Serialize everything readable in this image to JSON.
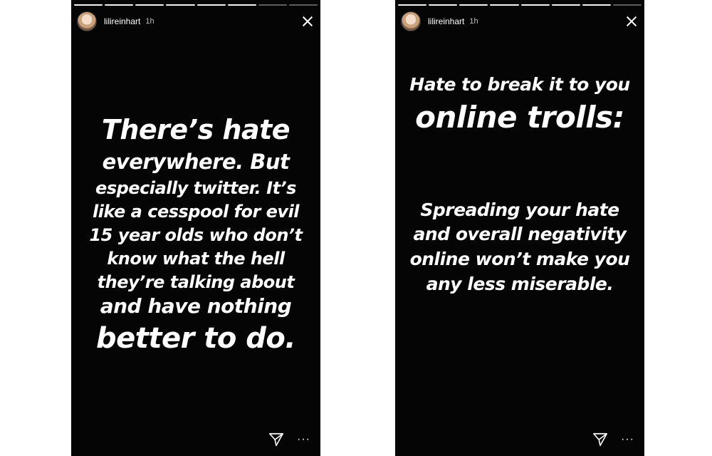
{
  "left_story": {
    "username": "lilireinhart",
    "time": "1h",
    "lines": [
      "There’s hate",
      "everywhere. But",
      "especially twitter. It’s",
      "like a cesspool for evil",
      "15 year olds who don’t",
      "know what the hell",
      "they’re talking about",
      "and have nothing",
      "better to do."
    ]
  },
  "right_story": {
    "username": "lilireinhart",
    "time": "1h",
    "heading_lines": [
      "Hate to break it to you",
      "online trolls:"
    ],
    "body_lines": [
      "Spreading your hate",
      "and overall negativity",
      "online won’t make you",
      "any less miserable."
    ]
  },
  "icons": {
    "more": "···"
  }
}
